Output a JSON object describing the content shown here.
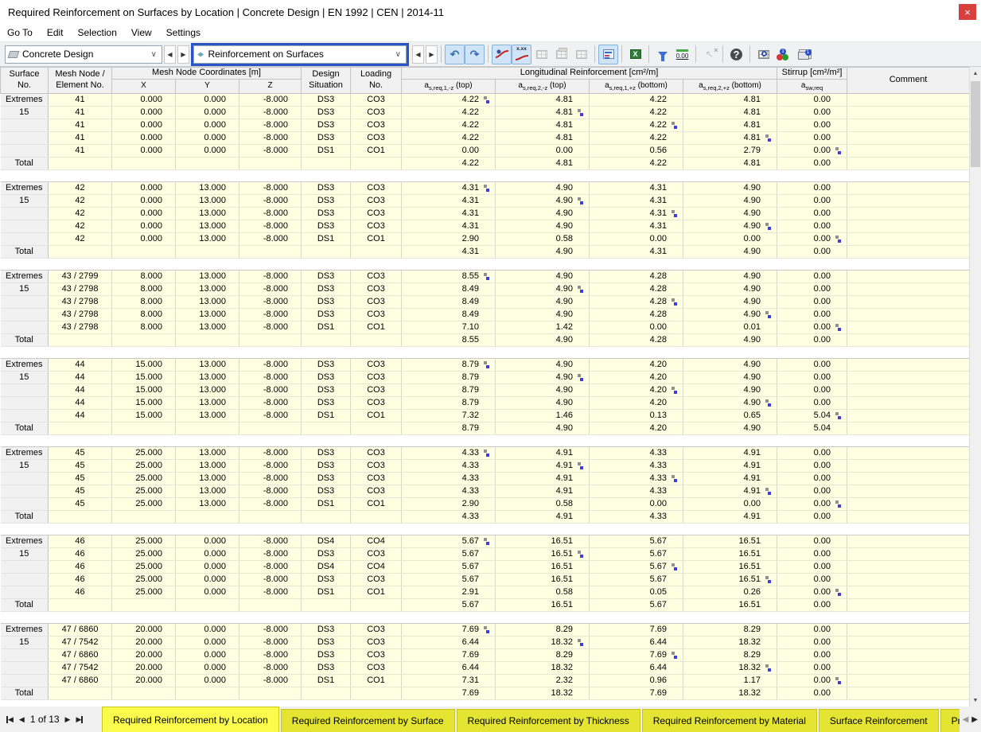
{
  "window": {
    "title": "Required Reinforcement on Surfaces by Location | Concrete Design | EN 1992 | CEN | 2014-11"
  },
  "menu": {
    "items": [
      "Go To",
      "Edit",
      "Selection",
      "View",
      "Settings"
    ]
  },
  "glyphs": {
    "close": "×",
    "chevron_down": "∨",
    "arrow_left": "◀",
    "arrow_right": "▶",
    "arrow_up": "▲",
    "arrow_down": "▼",
    "undo": "↶",
    "redo": "↷",
    "xxx": "x.xx",
    "decimals": "0.00",
    "excel_x": "X",
    "cursor": "↖",
    "help": "?",
    "badge_one": "1"
  },
  "toolbar": {
    "module_selector": {
      "value": "Concrete Design"
    },
    "table_selector": {
      "value": "Reinforcement on Surfaces"
    }
  },
  "table": {
    "header": {
      "surface": "Surface\nNo.",
      "mesh_node": "Mesh Node /\nElement No.",
      "coords_group": "Mesh Node Coordinates [m]",
      "coord_x": "X",
      "coord_y": "Y",
      "coord_z": "Z",
      "design": "Design\nSituation",
      "loading": "Loading\nNo.",
      "longitudinal_group": "Longitudinal Reinforcement [cm²/m]",
      "long_cols": [
        {
          "base": "a",
          "sub": "s,req,1,-z",
          "rest": "(top)"
        },
        {
          "base": "a",
          "sub": "s,req,2,-z",
          "rest": "(top)"
        },
        {
          "base": "a",
          "sub": "s,req,1,+z",
          "rest": "(bottom)"
        },
        {
          "base": "a",
          "sub": "s,req,2,+z",
          "rest": "(bottom)"
        }
      ],
      "stirrup_group": "Stirrup [cm²/m²]",
      "stirrup_col": {
        "base": "a",
        "sub": "sw,req",
        "rest": ""
      },
      "comment": "Comment"
    },
    "groups": [
      {
        "surface_label": "Extremes",
        "surface_no": "15",
        "total_label": "Total",
        "rows": [
          {
            "node": "41",
            "x": "0.000",
            "y": "0.000",
            "z": "-8.000",
            "ds": "DS3",
            "co": "CO3",
            "vals": [
              "4.22",
              "4.81",
              "4.22",
              "4.81",
              "0.00"
            ],
            "marker": 0
          },
          {
            "node": "41",
            "x": "0.000",
            "y": "0.000",
            "z": "-8.000",
            "ds": "DS3",
            "co": "CO3",
            "vals": [
              "4.22",
              "4.81",
              "4.22",
              "4.81",
              "0.00"
            ],
            "marker": 1
          },
          {
            "node": "41",
            "x": "0.000",
            "y": "0.000",
            "z": "-8.000",
            "ds": "DS3",
            "co": "CO3",
            "vals": [
              "4.22",
              "4.81",
              "4.22",
              "4.81",
              "0.00"
            ],
            "marker": 2
          },
          {
            "node": "41",
            "x": "0.000",
            "y": "0.000",
            "z": "-8.000",
            "ds": "DS3",
            "co": "CO3",
            "vals": [
              "4.22",
              "4.81",
              "4.22",
              "4.81",
              "0.00"
            ],
            "marker": 3
          },
          {
            "node": "41",
            "x": "0.000",
            "y": "0.000",
            "z": "-8.000",
            "ds": "DS1",
            "co": "CO1",
            "vals": [
              "0.00",
              "0.00",
              "0.56",
              "2.79",
              "0.00"
            ],
            "marker": 4
          }
        ],
        "total": [
          "4.22",
          "4.81",
          "4.22",
          "4.81",
          "0.00"
        ]
      },
      {
        "surface_label": "Extremes",
        "surface_no": "15",
        "total_label": "Total",
        "rows": [
          {
            "node": "42",
            "x": "0.000",
            "y": "13.000",
            "z": "-8.000",
            "ds": "DS3",
            "co": "CO3",
            "vals": [
              "4.31",
              "4.90",
              "4.31",
              "4.90",
              "0.00"
            ],
            "marker": 0
          },
          {
            "node": "42",
            "x": "0.000",
            "y": "13.000",
            "z": "-8.000",
            "ds": "DS3",
            "co": "CO3",
            "vals": [
              "4.31",
              "4.90",
              "4.31",
              "4.90",
              "0.00"
            ],
            "marker": 1
          },
          {
            "node": "42",
            "x": "0.000",
            "y": "13.000",
            "z": "-8.000",
            "ds": "DS3",
            "co": "CO3",
            "vals": [
              "4.31",
              "4.90",
              "4.31",
              "4.90",
              "0.00"
            ],
            "marker": 2
          },
          {
            "node": "42",
            "x": "0.000",
            "y": "13.000",
            "z": "-8.000",
            "ds": "DS3",
            "co": "CO3",
            "vals": [
              "4.31",
              "4.90",
              "4.31",
              "4.90",
              "0.00"
            ],
            "marker": 3
          },
          {
            "node": "42",
            "x": "0.000",
            "y": "13.000",
            "z": "-8.000",
            "ds": "DS1",
            "co": "CO1",
            "vals": [
              "2.90",
              "0.58",
              "0.00",
              "0.00",
              "0.00"
            ],
            "marker": 4
          }
        ],
        "total": [
          "4.31",
          "4.90",
          "4.31",
          "4.90",
          "0.00"
        ]
      },
      {
        "surface_label": "Extremes",
        "surface_no": "15",
        "total_label": "Total",
        "rows": [
          {
            "node": "43 / 2799",
            "x": "8.000",
            "y": "13.000",
            "z": "-8.000",
            "ds": "DS3",
            "co": "CO3",
            "vals": [
              "8.55",
              "4.90",
              "4.28",
              "4.90",
              "0.00"
            ],
            "marker": 0
          },
          {
            "node": "43 / 2798",
            "x": "8.000",
            "y": "13.000",
            "z": "-8.000",
            "ds": "DS3",
            "co": "CO3",
            "vals": [
              "8.49",
              "4.90",
              "4.28",
              "4.90",
              "0.00"
            ],
            "marker": 1
          },
          {
            "node": "43 / 2798",
            "x": "8.000",
            "y": "13.000",
            "z": "-8.000",
            "ds": "DS3",
            "co": "CO3",
            "vals": [
              "8.49",
              "4.90",
              "4.28",
              "4.90",
              "0.00"
            ],
            "marker": 2
          },
          {
            "node": "43 / 2798",
            "x": "8.000",
            "y": "13.000",
            "z": "-8.000",
            "ds": "DS3",
            "co": "CO3",
            "vals": [
              "8.49",
              "4.90",
              "4.28",
              "4.90",
              "0.00"
            ],
            "marker": 3
          },
          {
            "node": "43 / 2798",
            "x": "8.000",
            "y": "13.000",
            "z": "-8.000",
            "ds": "DS1",
            "co": "CO1",
            "vals": [
              "7.10",
              "1.42",
              "0.00",
              "0.01",
              "0.00"
            ],
            "marker": 4
          }
        ],
        "total": [
          "8.55",
          "4.90",
          "4.28",
          "4.90",
          "0.00"
        ]
      },
      {
        "surface_label": "Extremes",
        "surface_no": "15",
        "total_label": "Total",
        "rows": [
          {
            "node": "44",
            "x": "15.000",
            "y": "13.000",
            "z": "-8.000",
            "ds": "DS3",
            "co": "CO3",
            "vals": [
              "8.79",
              "4.90",
              "4.20",
              "4.90",
              "0.00"
            ],
            "marker": 0
          },
          {
            "node": "44",
            "x": "15.000",
            "y": "13.000",
            "z": "-8.000",
            "ds": "DS3",
            "co": "CO3",
            "vals": [
              "8.79",
              "4.90",
              "4.20",
              "4.90",
              "0.00"
            ],
            "marker": 1
          },
          {
            "node": "44",
            "x": "15.000",
            "y": "13.000",
            "z": "-8.000",
            "ds": "DS3",
            "co": "CO3",
            "vals": [
              "8.79",
              "4.90",
              "4.20",
              "4.90",
              "0.00"
            ],
            "marker": 2
          },
          {
            "node": "44",
            "x": "15.000",
            "y": "13.000",
            "z": "-8.000",
            "ds": "DS3",
            "co": "CO3",
            "vals": [
              "8.79",
              "4.90",
              "4.20",
              "4.90",
              "0.00"
            ],
            "marker": 3
          },
          {
            "node": "44",
            "x": "15.000",
            "y": "13.000",
            "z": "-8.000",
            "ds": "DS1",
            "co": "CO1",
            "vals": [
              "7.32",
              "1.46",
              "0.13",
              "0.65",
              "5.04"
            ],
            "marker": 4
          }
        ],
        "total": [
          "8.79",
          "4.90",
          "4.20",
          "4.90",
          "5.04"
        ]
      },
      {
        "surface_label": "Extremes",
        "surface_no": "15",
        "total_label": "Total",
        "rows": [
          {
            "node": "45",
            "x": "25.000",
            "y": "13.000",
            "z": "-8.000",
            "ds": "DS3",
            "co": "CO3",
            "vals": [
              "4.33",
              "4.91",
              "4.33",
              "4.91",
              "0.00"
            ],
            "marker": 0
          },
          {
            "node": "45",
            "x": "25.000",
            "y": "13.000",
            "z": "-8.000",
            "ds": "DS3",
            "co": "CO3",
            "vals": [
              "4.33",
              "4.91",
              "4.33",
              "4.91",
              "0.00"
            ],
            "marker": 1
          },
          {
            "node": "45",
            "x": "25.000",
            "y": "13.000",
            "z": "-8.000",
            "ds": "DS3",
            "co": "CO3",
            "vals": [
              "4.33",
              "4.91",
              "4.33",
              "4.91",
              "0.00"
            ],
            "marker": 2
          },
          {
            "node": "45",
            "x": "25.000",
            "y": "13.000",
            "z": "-8.000",
            "ds": "DS3",
            "co": "CO3",
            "vals": [
              "4.33",
              "4.91",
              "4.33",
              "4.91",
              "0.00"
            ],
            "marker": 3
          },
          {
            "node": "45",
            "x": "25.000",
            "y": "13.000",
            "z": "-8.000",
            "ds": "DS1",
            "co": "CO1",
            "vals": [
              "2.90",
              "0.58",
              "0.00",
              "0.00",
              "0.00"
            ],
            "marker": 4
          }
        ],
        "total": [
          "4.33",
          "4.91",
          "4.33",
          "4.91",
          "0.00"
        ]
      },
      {
        "surface_label": "Extremes",
        "surface_no": "15",
        "total_label": "Total",
        "rows": [
          {
            "node": "46",
            "x": "25.000",
            "y": "0.000",
            "z": "-8.000",
            "ds": "DS4",
            "co": "CO4",
            "vals": [
              "5.67",
              "16.51",
              "5.67",
              "16.51",
              "0.00"
            ],
            "marker": 0
          },
          {
            "node": "46",
            "x": "25.000",
            "y": "0.000",
            "z": "-8.000",
            "ds": "DS3",
            "co": "CO3",
            "vals": [
              "5.67",
              "16.51",
              "5.67",
              "16.51",
              "0.00"
            ],
            "marker": 1
          },
          {
            "node": "46",
            "x": "25.000",
            "y": "0.000",
            "z": "-8.000",
            "ds": "DS4",
            "co": "CO4",
            "vals": [
              "5.67",
              "16.51",
              "5.67",
              "16.51",
              "0.00"
            ],
            "marker": 2
          },
          {
            "node": "46",
            "x": "25.000",
            "y": "0.000",
            "z": "-8.000",
            "ds": "DS3",
            "co": "CO3",
            "vals": [
              "5.67",
              "16.51",
              "5.67",
              "16.51",
              "0.00"
            ],
            "marker": 3
          },
          {
            "node": "46",
            "x": "25.000",
            "y": "0.000",
            "z": "-8.000",
            "ds": "DS1",
            "co": "CO1",
            "vals": [
              "2.91",
              "0.58",
              "0.05",
              "0.26",
              "0.00"
            ],
            "marker": 4
          }
        ],
        "total": [
          "5.67",
          "16.51",
          "5.67",
          "16.51",
          "0.00"
        ]
      },
      {
        "surface_label": "Extremes",
        "surface_no": "15",
        "total_label": "Total",
        "rows": [
          {
            "node": "47 / 6860",
            "x": "20.000",
            "y": "0.000",
            "z": "-8.000",
            "ds": "DS3",
            "co": "CO3",
            "vals": [
              "7.69",
              "8.29",
              "7.69",
              "8.29",
              "0.00"
            ],
            "marker": 0
          },
          {
            "node": "47 / 7542",
            "x": "20.000",
            "y": "0.000",
            "z": "-8.000",
            "ds": "DS3",
            "co": "CO3",
            "vals": [
              "6.44",
              "18.32",
              "6.44",
              "18.32",
              "0.00"
            ],
            "marker": 1
          },
          {
            "node": "47 / 6860",
            "x": "20.000",
            "y": "0.000",
            "z": "-8.000",
            "ds": "DS3",
            "co": "CO3",
            "vals": [
              "7.69",
              "8.29",
              "7.69",
              "8.29",
              "0.00"
            ],
            "marker": 2
          },
          {
            "node": "47 / 7542",
            "x": "20.000",
            "y": "0.000",
            "z": "-8.000",
            "ds": "DS3",
            "co": "CO3",
            "vals": [
              "6.44",
              "18.32",
              "6.44",
              "18.32",
              "0.00"
            ],
            "marker": 3
          },
          {
            "node": "47 / 6860",
            "x": "20.000",
            "y": "0.000",
            "z": "-8.000",
            "ds": "DS1",
            "co": "CO1",
            "vals": [
              "7.31",
              "2.32",
              "0.96",
              "1.17",
              "0.00"
            ],
            "marker": 4
          }
        ],
        "total": [
          "7.69",
          "18.32",
          "7.69",
          "18.32",
          "0.00"
        ]
      }
    ]
  },
  "footer": {
    "page_indicator": "1 of 13",
    "tabs": [
      {
        "label": "Required Reinforcement by Location",
        "active": true
      },
      {
        "label": "Required Reinforcement by Surface",
        "active": false
      },
      {
        "label": "Required Reinforcement by Thickness",
        "active": false
      },
      {
        "label": "Required Reinforcement by Material",
        "active": false
      },
      {
        "label": "Surface Reinforcement",
        "active": false
      },
      {
        "label": "Provided Reinforcement",
        "active": false
      }
    ]
  }
}
